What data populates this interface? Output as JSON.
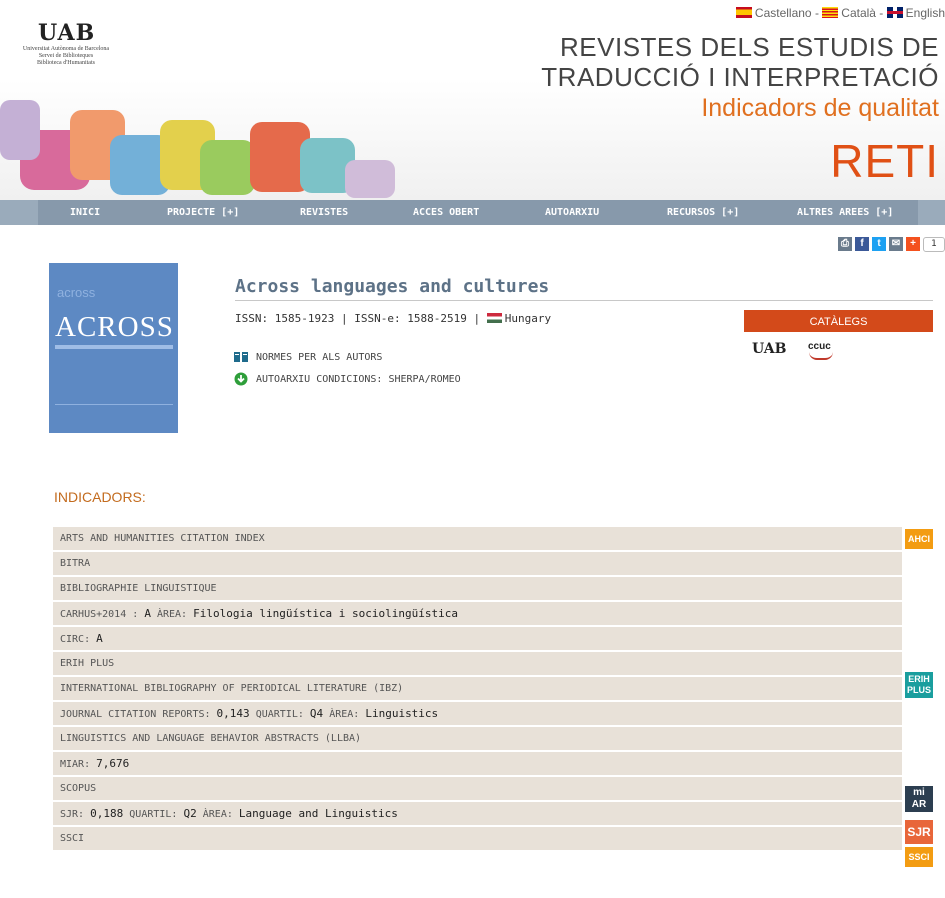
{
  "languages": [
    {
      "flag": "es",
      "label": "Castellano"
    },
    {
      "flag": "ca",
      "label": "Català"
    },
    {
      "flag": "en",
      "label": "English"
    }
  ],
  "lang_separator": " - ",
  "logo": {
    "text": "UAB",
    "line1": "Universitat Autònoma de Barcelona",
    "line2": "Servei de Biblioteques",
    "line3": "Biblioteca d'Humanitats"
  },
  "header": {
    "title_line1": "REVISTES DELS ESTUDIS DE",
    "title_line2": "TRADUCCIÓ I INTERPRETACIÓ",
    "subtitle": "Indicadors de qualitat",
    "acronym": "RETI"
  },
  "nav": [
    {
      "label": "INICI"
    },
    {
      "label": "PROJECTE [+]"
    },
    {
      "label": "REVISTES"
    },
    {
      "label": "ACCES OBERT"
    },
    {
      "label": "AUTOARXIU"
    },
    {
      "label": "RECURSOS [+]"
    },
    {
      "label": "ALTRES AREES [+]"
    }
  ],
  "share": {
    "count": "1",
    "colors": {
      "print": "#6a7b8c",
      "facebook": "#3b5998",
      "twitter": "#1da1f2",
      "email": "#6a7b8c",
      "addthis": "#f4511e"
    }
  },
  "cover": {
    "small_text": "across",
    "big_text": "ACROSS"
  },
  "journal": {
    "title": "Across languages and cultures",
    "issn_label": "ISSN:",
    "issn": "1585-1923",
    "issne_label": "ISSN-e:",
    "issne": "1588-2519",
    "country": "Hungary",
    "links": [
      {
        "icon": "book-icon",
        "label": "NORMES PER ALS AUTORS"
      },
      {
        "icon": "download-icon",
        "label": "AUTOARXIU CONDICIONS: SHERPA/ROMEO"
      }
    ]
  },
  "catalegs": {
    "label": "CATÀLEGS",
    "logo1": "UAB",
    "logo2": "ccuc"
  },
  "indicadors": {
    "heading": "INDICADORS:",
    "rows": [
      {
        "label": "ARTS AND HUMANITIES CITATION INDEX",
        "badge": "AHCI",
        "badge_color": "#f39c12"
      },
      {
        "label": "BITRA"
      },
      {
        "label": "BIBLIOGRAPHIE LINGUISTIQUE"
      },
      {
        "label": "CARHUS+2014 :",
        "value": "A",
        "extra_label": "ÀREA:",
        "extra_value": "Filologia lingüística i sociolingüística"
      },
      {
        "label": "CIRC:",
        "value": "A"
      },
      {
        "label": "ERIH PLUS",
        "badge": "ERIH PLUS",
        "badge_color": "#1a9e9e"
      },
      {
        "label": "INTERNATIONAL BIBLIOGRAPHY OF PERIODICAL LITERATURE (IBZ)"
      },
      {
        "label": "JOURNAL CITATION REPORTS:",
        "value": "0,143",
        "extra_label": "QUARTIL:",
        "extra_value": "Q4",
        "extra2_label": "ÀREA:",
        "extra2_value": "Linguistics"
      },
      {
        "label": "LINGUISTICS AND LANGUAGE BEHAVIOR ABSTRACTS (LLBA)"
      },
      {
        "label": "MIAR:",
        "value": "7,676",
        "badge": "mi AR",
        "badge_color": "#2c3e50"
      },
      {
        "label": "SCOPUS"
      },
      {
        "label": "SJR:",
        "value": "0,188",
        "extra_label": "QUARTIL:",
        "extra_value": "Q2",
        "extra2_label": "ÀREA:",
        "extra2_value": "Language and Linguistics",
        "badge": "SJR",
        "badge_color": "#e8663a"
      },
      {
        "label": "SSCI",
        "badge": "SSCI",
        "badge_color": "#f39c12"
      }
    ]
  }
}
